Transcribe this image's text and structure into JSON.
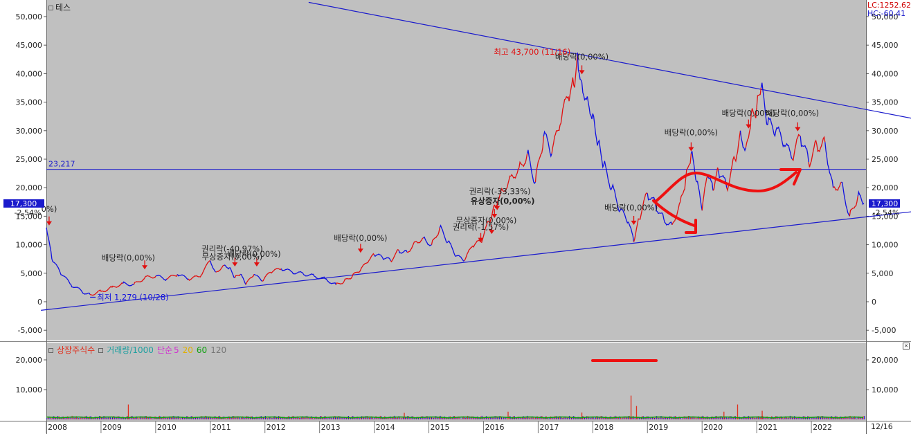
{
  "title": "테스",
  "info": {
    "lc": "LC:1252.62",
    "hc": "HC:-60.41"
  },
  "price_y_ticks": [
    "50,000",
    "45,000",
    "40,000",
    "35,000",
    "30,000",
    "25,000",
    "20,000",
    "15,000",
    "10,000",
    "5,000",
    "0",
    "-5,000"
  ],
  "volume_y_ticks": [
    "20,000",
    "10,000"
  ],
  "volume_legend": [
    {
      "label": "상장주식수",
      "color": "#e0301e"
    },
    {
      "label": "거래량/1000",
      "color": "#20a0a0"
    },
    {
      "label": "단순",
      "color": "#d030d0"
    },
    {
      "label": "5",
      "color": "#d030d0"
    },
    {
      "label": "20",
      "color": "#e0b000"
    },
    {
      "label": "60",
      "color": "#10a010"
    },
    {
      "label": "120",
      "color": "#777777"
    }
  ],
  "current_price": {
    "value": "17,300",
    "change": "-2.54%"
  },
  "last_date": "12/16",
  "colors": {
    "up": "#e01010",
    "down": "#1010e0",
    "trendline": "#1a1acc",
    "background": "#c0c0c0",
    "annotation_red": "#e01010"
  },
  "chart_data": {
    "type": "line",
    "x_ticks": [
      "2008",
      "2009",
      "2010",
      "2011",
      "2012",
      "2013",
      "2014",
      "2015",
      "2016",
      "2017",
      "2018",
      "2019",
      "2020",
      "2021",
      "2022"
    ],
    "y_range": [
      -5000,
      50000
    ],
    "price_series": [
      [
        2008.0,
        13000
      ],
      [
        2008.1,
        7500
      ],
      [
        2008.25,
        5200
      ],
      [
        2008.45,
        3000
      ],
      [
        2008.65,
        1800
      ],
      [
        2008.8,
        1279
      ],
      [
        2009.0,
        1800
      ],
      [
        2009.2,
        2500
      ],
      [
        2009.4,
        3200
      ],
      [
        2009.6,
        3000
      ],
      [
        2009.8,
        4200
      ],
      [
        2010.0,
        4500
      ],
      [
        2010.2,
        4000
      ],
      [
        2010.4,
        4800
      ],
      [
        2010.6,
        4000
      ],
      [
        2010.8,
        4400
      ],
      [
        2011.0,
        7200
      ],
      [
        2011.1,
        5200
      ],
      [
        2011.25,
        6400
      ],
      [
        2011.35,
        6000
      ],
      [
        2011.45,
        4200
      ],
      [
        2011.55,
        4800
      ],
      [
        2011.65,
        3000
      ],
      [
        2011.8,
        4800
      ],
      [
        2011.95,
        3600
      ],
      [
        2012.1,
        5200
      ],
      [
        2012.3,
        5800
      ],
      [
        2012.5,
        5200
      ],
      [
        2012.7,
        4900
      ],
      [
        2012.9,
        4500
      ],
      [
        2013.1,
        4000
      ],
      [
        2013.3,
        3000
      ],
      [
        2013.45,
        3600
      ],
      [
        2013.6,
        4500
      ],
      [
        2013.75,
        5600
      ],
      [
        2013.9,
        7200
      ],
      [
        2014.0,
        8200
      ],
      [
        2014.15,
        7800
      ],
      [
        2014.3,
        7200
      ],
      [
        2014.45,
        9000
      ],
      [
        2014.6,
        8700
      ],
      [
        2014.75,
        10500
      ],
      [
        2014.9,
        11200
      ],
      [
        2015.05,
        10000
      ],
      [
        2015.2,
        13000
      ],
      [
        2015.35,
        10500
      ],
      [
        2015.5,
        8000
      ],
      [
        2015.65,
        7200
      ],
      [
        2015.8,
        9800
      ],
      [
        2015.95,
        10500
      ],
      [
        2016.1,
        14000
      ],
      [
        2016.2,
        17000
      ],
      [
        2016.35,
        19500
      ],
      [
        2016.5,
        22000
      ],
      [
        2016.65,
        23500
      ],
      [
        2016.8,
        26000
      ],
      [
        2016.95,
        21000
      ],
      [
        2017.1,
        29000
      ],
      [
        2017.25,
        26000
      ],
      [
        2017.4,
        31000
      ],
      [
        2017.55,
        36000
      ],
      [
        2017.65,
        38000
      ],
      [
        2017.72,
        43700
      ],
      [
        2017.8,
        38500
      ],
      [
        2017.9,
        36000
      ],
      [
        2018.0,
        33000
      ],
      [
        2018.1,
        28000
      ],
      [
        2018.2,
        24000
      ],
      [
        2018.35,
        20000
      ],
      [
        2018.5,
        16000
      ],
      [
        2018.65,
        14000
      ],
      [
        2018.75,
        10500
      ],
      [
        2018.85,
        14500
      ],
      [
        2019.0,
        19000
      ],
      [
        2019.15,
        17000
      ],
      [
        2019.3,
        14500
      ],
      [
        2019.45,
        13500
      ],
      [
        2019.6,
        17500
      ],
      [
        2019.7,
        21500
      ],
      [
        2019.8,
        26000
      ],
      [
        2019.9,
        21000
      ],
      [
        2020.0,
        16000
      ],
      [
        2020.1,
        22000
      ],
      [
        2020.2,
        19500
      ],
      [
        2020.3,
        23000
      ],
      [
        2020.45,
        20000
      ],
      [
        2020.6,
        25000
      ],
      [
        2020.7,
        30000
      ],
      [
        2020.8,
        27000
      ],
      [
        2020.9,
        33000
      ],
      [
        2021.0,
        34000
      ],
      [
        2021.08,
        37500
      ],
      [
        2021.2,
        31000
      ],
      [
        2021.35,
        30000
      ],
      [
        2021.5,
        27500
      ],
      [
        2021.65,
        25000
      ],
      [
        2021.8,
        29000
      ],
      [
        2021.95,
        24500
      ],
      [
        2022.1,
        27500
      ],
      [
        2022.25,
        28000
      ],
      [
        2022.4,
        20000
      ],
      [
        2022.55,
        21000
      ],
      [
        2022.7,
        15000
      ],
      [
        2022.85,
        18500
      ],
      [
        2022.96,
        17300
      ]
    ],
    "resistance_line": {
      "from": [
        2012.8,
        52500
      ],
      "to": [
        2028.0,
        24500
      ]
    },
    "support_line": {
      "from": [
        2007.9,
        -1500
      ],
      "to": [
        2028.0,
        20300
      ]
    },
    "horizontal_line": {
      "value": 23217,
      "label": "23,217"
    },
    "high": {
      "label": "최고 43,700 (11/16)",
      "x": 2017.72,
      "value": 43700
    },
    "low": {
      "label": "최저 1,279 (10/28)",
      "x": 2008.8,
      "value": 1279
    },
    "annotations": [
      {
        "text": "0%)",
        "x": 2008.05,
        "y": 15800
      },
      {
        "text": "배당락(0,00%)",
        "x": 2009.5,
        "y": 7200
      },
      {
        "text": "권리락(-40,97%)",
        "x": 2011.4,
        "y": 8800
      },
      {
        "text": "무상증자(0,00%)",
        "x": 2011.4,
        "y": 7400
      },
      {
        "text": "배당락(0,00%)",
        "x": 2011.8,
        "y": 7900
      },
      {
        "text": "배당락(0,00%)",
        "x": 2013.75,
        "y": 10700
      },
      {
        "text": "권리락(-33,33%)",
        "x": 2016.3,
        "y": 18900
      },
      {
        "text": "유상증자(0,00%)",
        "x": 2016.35,
        "y": 17200,
        "bold": true
      },
      {
        "text": "무상증자(0,00%)",
        "x": 2016.05,
        "y": 13800
      },
      {
        "text": "권리락(-1,57%)",
        "x": 2015.95,
        "y": 12600
      },
      {
        "text": "배당락(0,00%)",
        "x": 2017.8,
        "y": 42500
      },
      {
        "text": "배당락(0,00%)",
        "x": 2018.7,
        "y": 16000
      },
      {
        "text": "배당락(0,00%)",
        "x": 2019.8,
        "y": 29200
      },
      {
        "text": "배당락(0,00%)",
        "x": 2020.85,
        "y": 32600
      },
      {
        "text": "배당락(0,00%)",
        "x": 2021.65,
        "y": 32600
      }
    ],
    "event_markers": [
      [
        2008.05,
        13500
      ],
      [
        2009.8,
        5800
      ],
      [
        2011.45,
        6300
      ],
      [
        2011.85,
        6300
      ],
      [
        2013.75,
        8700
      ],
      [
        2015.95,
        10600
      ],
      [
        2016.15,
        12000
      ],
      [
        2016.2,
        14800
      ],
      [
        2016.25,
        16200
      ],
      [
        2017.8,
        40000
      ],
      [
        2018.75,
        13600
      ],
      [
        2019.8,
        26500
      ],
      [
        2020.85,
        30500
      ],
      [
        2021.75,
        30000
      ]
    ],
    "volume_spikes": [
      [
        2009.5,
        5000
      ],
      [
        2018.7,
        8000
      ],
      [
        2018.8,
        4500
      ],
      [
        2020.65,
        5000
      ],
      [
        2020.4,
        2600
      ],
      [
        2014.55,
        2200
      ],
      [
        2016.45,
        2600
      ],
      [
        2017.8,
        2300
      ],
      [
        2021.1,
        2900
      ]
    ]
  }
}
